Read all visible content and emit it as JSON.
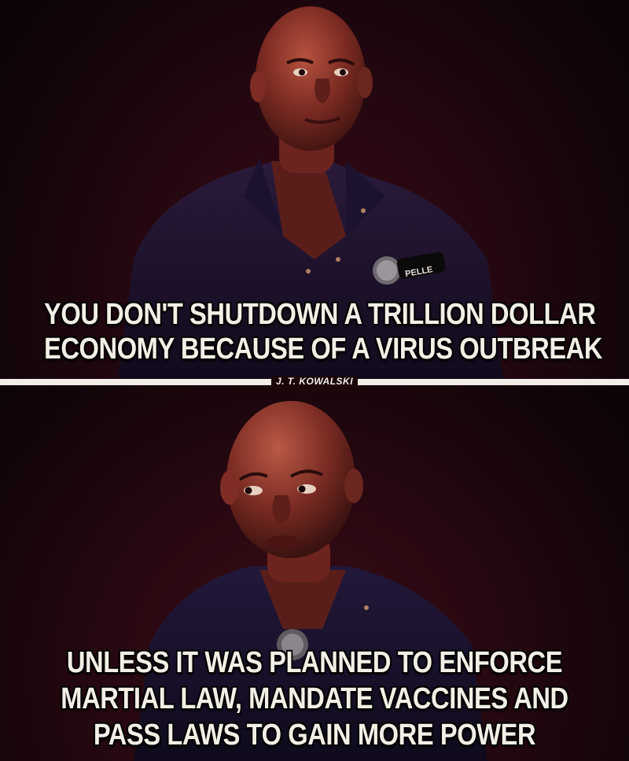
{
  "meme": {
    "top_caption": [
      "YOU DON'T SHUTDOWN A TRILLION DOLLAR",
      "ECONOMY BECAUSE OF A VIRUS OUTBREAK"
    ],
    "watermark": "J. T. KOWALSKI",
    "mic_label": "PELLE",
    "bottom_caption": [
      "UNLESS IT WAS PLANNED TO ENFORCE",
      "MARTIAL LAW, MANDATE VACCINES AND",
      "PASS LAWS TO GAIN MORE POWER"
    ]
  }
}
